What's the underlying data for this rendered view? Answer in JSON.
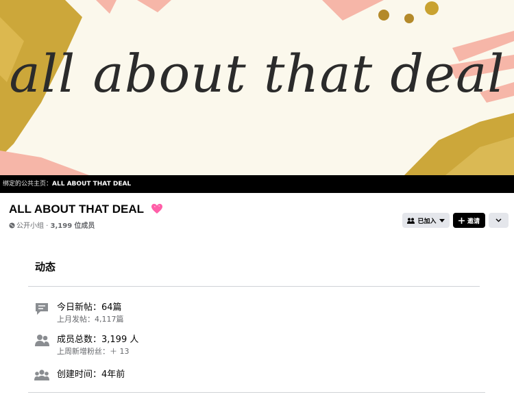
{
  "cover": {
    "title_text": "all about that deal",
    "colors": {
      "background": "#fbf8ec",
      "gold": "#c9a230",
      "pink": "#f6b6a8"
    }
  },
  "linked_page": {
    "prefix": "绑定的公共主页：",
    "name": "ALL ABOUT THAT DEAL"
  },
  "group": {
    "name": "ALL ABOUT THAT DEAL",
    "privacy": "公开小组",
    "separator": " · ",
    "member_count": "3,199",
    "member_label": "位成员"
  },
  "actions": {
    "joined_label": "已加入",
    "invite_label": "邀请"
  },
  "activity": {
    "title": "动态",
    "stats": [
      {
        "icon": "chat-icon",
        "primary": "今日新帖：64篇",
        "secondary": "上月发帖：4,117篇"
      },
      {
        "icon": "members-icon",
        "primary": "成员总数：3,199 人",
        "secondary": "上周新增粉丝：＋ 13"
      },
      {
        "icon": "group-icon",
        "primary": "创建时间：4年前"
      }
    ]
  }
}
